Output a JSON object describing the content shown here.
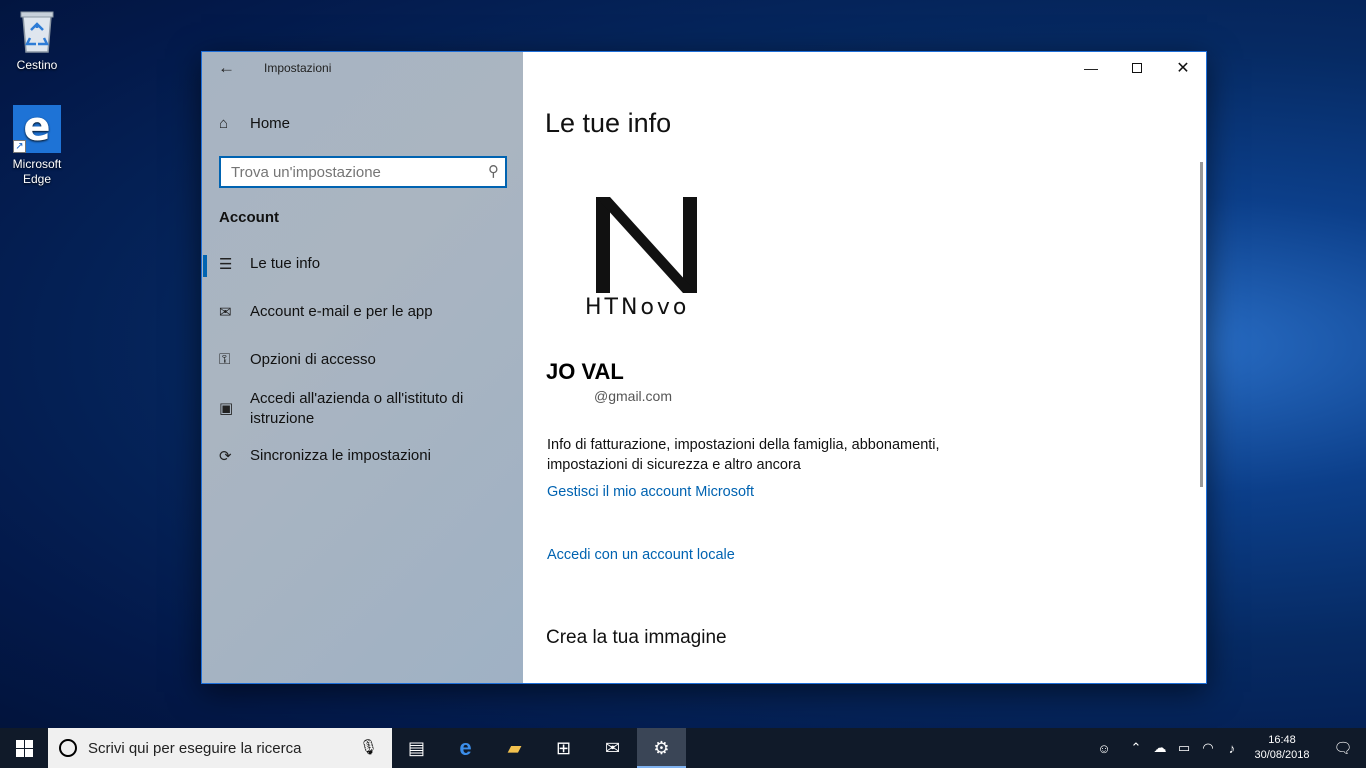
{
  "desktop": {
    "icons": [
      {
        "label": "Cestino",
        "icon": "recycle-bin-icon"
      },
      {
        "label": "Microsoft Edge",
        "icon": "edge-icon"
      }
    ]
  },
  "window": {
    "app_title": "Impostazioni",
    "sidebar": {
      "home_label": "Home",
      "search_placeholder": "Trova un'impostazione",
      "section_label": "Account",
      "items": [
        {
          "label": "Le tue info",
          "icon": "person-icon",
          "active": true
        },
        {
          "label": "Account e-mail e per le app",
          "icon": "mail-icon",
          "active": false
        },
        {
          "label": "Opzioni di accesso",
          "icon": "key-icon",
          "active": false
        },
        {
          "label": "Accedi all'azienda o all'istituto di istruzione",
          "icon": "briefcase-icon",
          "active": false
        },
        {
          "label": "Sincronizza le impostazioni",
          "icon": "sync-icon",
          "active": false
        }
      ]
    },
    "content": {
      "title": "Le tue info",
      "logo_text": "HTNovo",
      "user_name": "JO VAL",
      "user_email": "@gmail.com",
      "info_text": "Info di fatturazione, impostazioni della famiglia, abbonamenti, impostazioni di sicurezza e altro ancora",
      "manage_link": "Gestisci il mio account Microsoft",
      "local_link": "Accedi con un account locale",
      "create_heading": "Crea la tua immagine"
    }
  },
  "taskbar": {
    "search_placeholder": "Scrivi qui per eseguire la ricerca",
    "time": "16:48",
    "date": "30/08/2018"
  },
  "colors": {
    "accent": "#0063b1",
    "link": "#0063b1",
    "taskbar": "#101a29"
  }
}
